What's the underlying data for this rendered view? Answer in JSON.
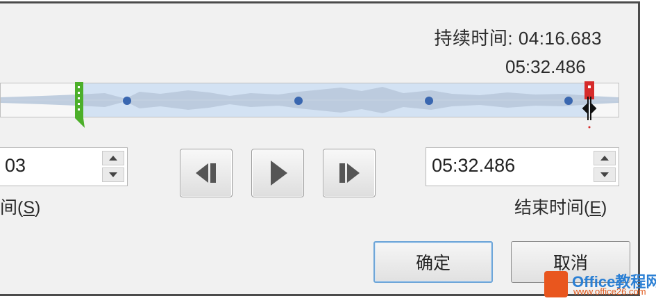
{
  "duration": {
    "label": "持续时间:",
    "value": "04:16.683"
  },
  "end_readout": "05:32.486",
  "start_time": {
    "value": "03",
    "label_prefix": "间(",
    "mnemonic": "S",
    "label_suffix": ")"
  },
  "end_time": {
    "value": "05:32.486",
    "label_prefix": "结束时间(",
    "mnemonic": "E",
    "label_suffix": ")"
  },
  "transport": {
    "previous_icon": "previous-bookmark-icon",
    "play_icon": "play-icon",
    "next_icon": "next-bookmark-icon"
  },
  "buttons": {
    "ok": "确定",
    "cancel": "取消"
  },
  "watermark": {
    "brand": "Office教程网",
    "url": "www.office26.com"
  },
  "colors": {
    "start_handle": "#4caf2a",
    "end_handle": "#d62b2b",
    "selection": "#d3e2f3",
    "bookmark": "#3a67b0",
    "default_button_border": "#6fa6d8"
  }
}
